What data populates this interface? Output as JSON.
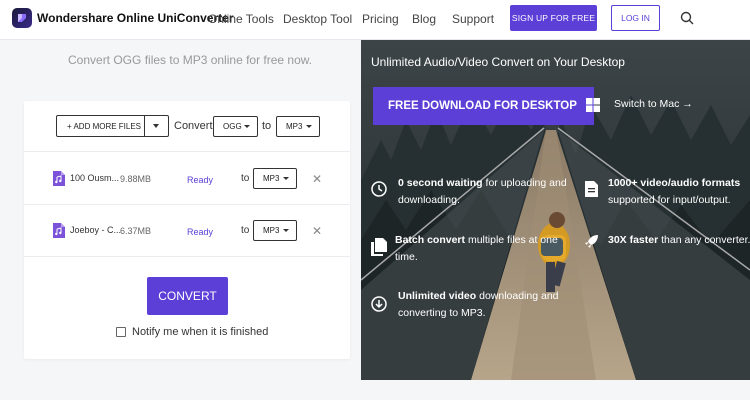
{
  "header": {
    "brand": "Wondershare Online UniConverter",
    "nav": [
      "Online Tools",
      "Desktop Tool",
      "Pricing",
      "Blog",
      "Support"
    ],
    "signup": "SIGN UP FOR FREE",
    "login": "LOG IN"
  },
  "converter": {
    "subtitle": "Convert OGG files to MP3 online for free now.",
    "add_more": "+ ADD MORE FILES",
    "convert_label": "Convert",
    "from_format": "OGG",
    "to_label": "to",
    "to_format": "MP3",
    "files": [
      {
        "name": "100 Ousm...",
        "size": "9.88MB",
        "status": "Ready",
        "to": "to",
        "format": "MP3"
      },
      {
        "name": "Joeboy - C...",
        "size": "6.37MB",
        "status": "Ready",
        "to": "to",
        "format": "MP3"
      }
    ],
    "convert_button": "CONVERT",
    "notify": "Notify me when it is finished"
  },
  "promo": {
    "headline": "Unlimited Audio/Video Convert on Your Desktop",
    "download": "FREE DOWNLOAD FOR DESKTOP",
    "switch": "Switch to Mac →",
    "features": [
      {
        "bold": "0 second waiting",
        "rest": " for uploading and downloading."
      },
      {
        "bold": "1000+ video/audio formats",
        "rest": " supported for input/output."
      },
      {
        "bold": "Batch convert",
        "rest": " multiple files at one time."
      },
      {
        "bold": "30X faster",
        "rest": " than any converter."
      },
      {
        "bold": "Unlimited video",
        "rest": " downloading and converting to MP3."
      }
    ]
  },
  "colors": {
    "accent": "#5b3fd6",
    "status": "#5b3fd6"
  },
  "icons": [
    "logo-icon",
    "search-icon",
    "audio-file-icon",
    "close-icon",
    "windows-icon",
    "clock-icon",
    "document-icon",
    "files-icon",
    "rocket-icon",
    "download-icon"
  ]
}
